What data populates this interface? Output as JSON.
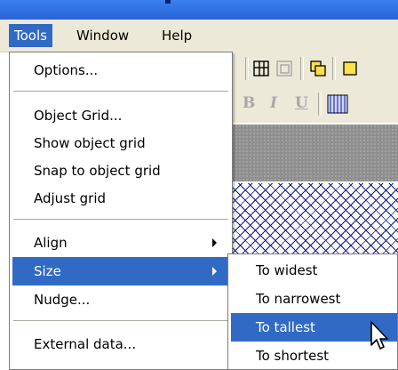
{
  "menubar": {
    "items": [
      {
        "label": "Tools"
      },
      {
        "label": "Window"
      },
      {
        "label": "Help"
      }
    ]
  },
  "toolbar": {
    "icons": [
      "grid-align-icon",
      "grid-snap-icon",
      "bring-front-icon",
      "send-back-icon"
    ]
  },
  "format_bar": {
    "bold": "B",
    "italic": "I",
    "underline": "U"
  },
  "tools_menu": {
    "items": [
      {
        "label": "Options..."
      },
      {
        "label": "Object Grid..."
      },
      {
        "label": "Show object grid"
      },
      {
        "label": "Snap to object grid"
      },
      {
        "label": "Adjust grid"
      },
      {
        "label": "Align"
      },
      {
        "label": "Size"
      },
      {
        "label": "Nudge..."
      },
      {
        "label": "External data..."
      }
    ]
  },
  "size_submenu": {
    "items": [
      {
        "label": "To widest"
      },
      {
        "label": "To narrowest"
      },
      {
        "label": "To tallest"
      },
      {
        "label": "To shortest"
      }
    ]
  },
  "colors": {
    "highlight": "#316ac5",
    "menubar": "#ece9d8",
    "hatch": "#0b1a8a"
  }
}
